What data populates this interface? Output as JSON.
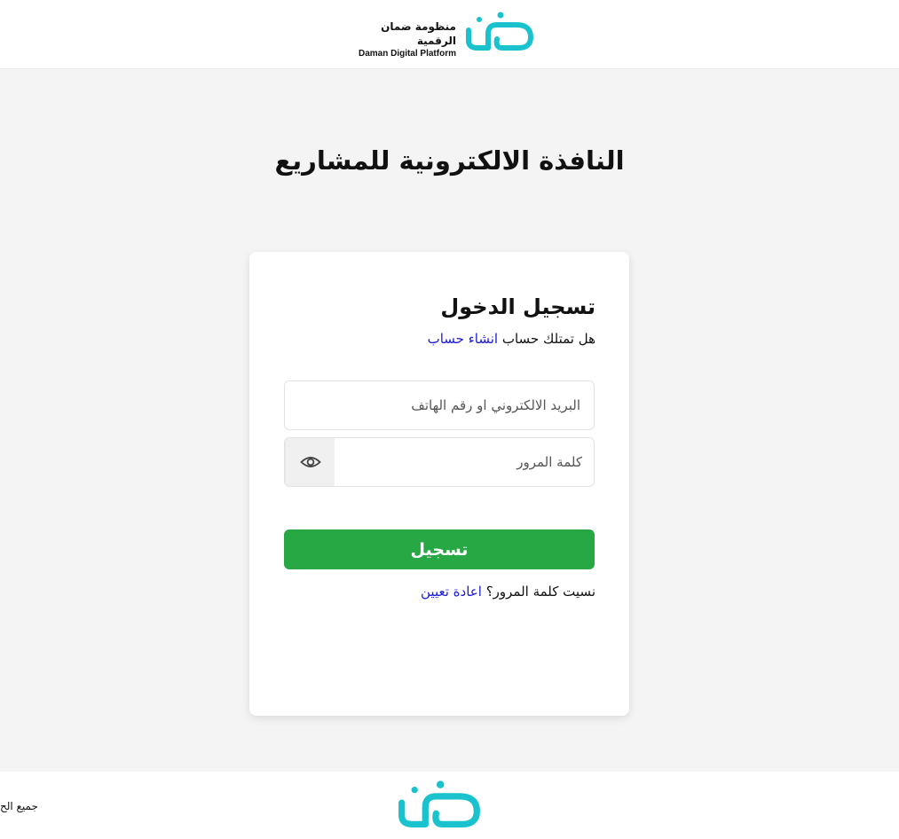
{
  "header": {
    "brand_ar": "منظومة ضمان الرقمية",
    "brand_en": "Daman Digital Platform",
    "logo_icon": "daman-logo-icon"
  },
  "page": {
    "title": "النافذة الالكترونية للمشاريع"
  },
  "login": {
    "title": "تسجيل الدخول",
    "signup_prompt": "هل تمتلك حساب",
    "signup_link": "انشاء حساب",
    "email_placeholder": "البريد الالكتروني او رقم الهاتف",
    "email_value": "",
    "password_placeholder": "كلمة المرور",
    "password_value": "",
    "password_toggle_icon": "eye-icon",
    "submit_label": "تسجيل",
    "forgot_prompt": "نسيت كلمة المرور؟",
    "forgot_link": "اعادة تعيين"
  },
  "footer": {
    "copyright": "جميع الح"
  },
  "colors": {
    "brand_teal": "#19c2cc",
    "primary_green": "#28a745",
    "link_blue": "#1a1ad9",
    "background": "#f4f4f4"
  }
}
